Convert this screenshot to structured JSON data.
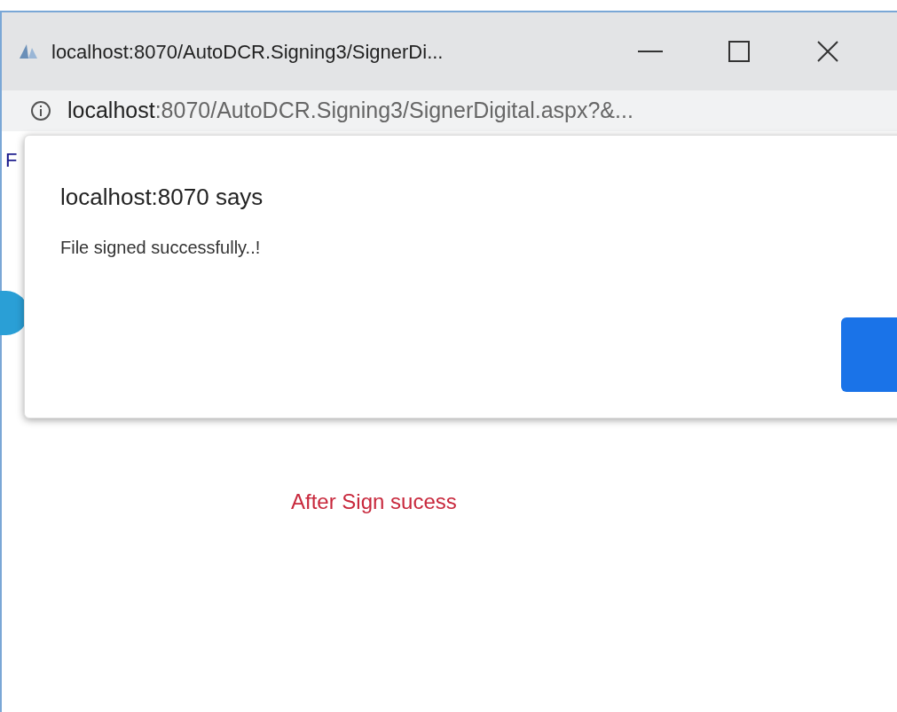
{
  "window": {
    "title": "localhost:8070/AutoDCR.Signing3/SignerDi..."
  },
  "address_bar": {
    "host": "localhost",
    "rest": ":8070/AutoDCR.Signing3/SignerDigital.aspx?&..."
  },
  "page": {
    "partial_text": "F"
  },
  "dialog": {
    "title": "localhost:8070 says",
    "message": "File signed successfully..!"
  },
  "annotation": "After Sign sucess"
}
